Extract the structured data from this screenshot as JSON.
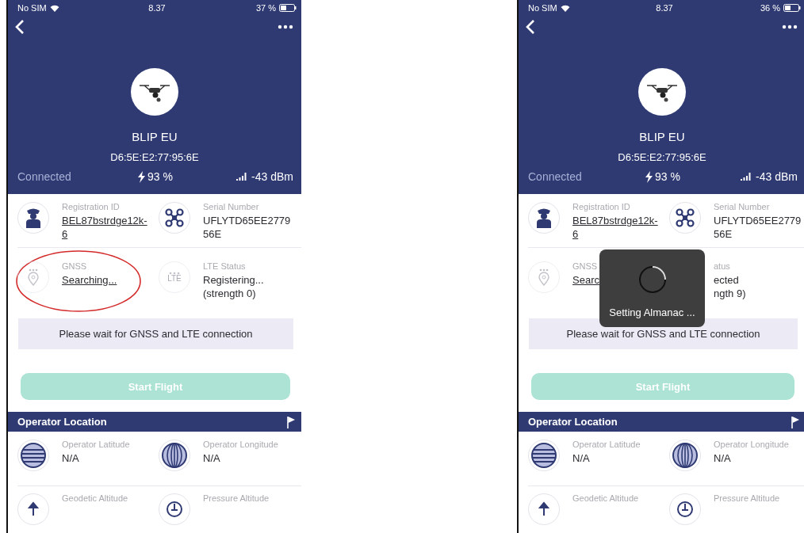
{
  "phones": [
    {
      "status_bar": {
        "carrier": "No SIM",
        "time": "8.37",
        "battery": "37 %"
      },
      "device": {
        "name": "BLIP EU",
        "address": "D6:5E:E2:77:95:6E",
        "connection": "Connected",
        "battery": "93 %",
        "signal": "-43 dBm"
      },
      "info_rows": [
        [
          {
            "kind": "officer",
            "label": "Registration ID",
            "value": "BEL87bstrdge12k-6",
            "link": true
          },
          {
            "kind": "drone",
            "label": "Serial Number",
            "value": "UFLYTD65EE277956E",
            "link": false
          }
        ],
        [
          {
            "kind": "gnss",
            "label": "GNSS",
            "value": "Searching...",
            "link": true,
            "dimmed": true,
            "annotated": true
          },
          {
            "kind": "lte",
            "icon_text": "LTE",
            "label": "LTE Status",
            "value": "Registering... (strength 0)",
            "link": false,
            "dimmed": true
          }
        ]
      ],
      "notice": "Please wait for GNSS and LTE connection",
      "action": {
        "label": "Start Flight",
        "disabled": true
      },
      "section": {
        "title": "Operator Location"
      },
      "location_rows": [
        [
          {
            "kind": "latitude",
            "label": "Operator Latitude",
            "value": "N/A"
          },
          {
            "kind": "longitude",
            "label": "Operator Longitude",
            "value": "N/A"
          }
        ],
        [
          {
            "kind": "geodetic",
            "label": "Geodetic Altitude"
          },
          {
            "kind": "pressure",
            "label": "Pressure Altitude"
          }
        ]
      ]
    },
    {
      "status_bar": {
        "carrier": "No SIM",
        "time": "8.37",
        "battery": "36 %"
      },
      "device": {
        "name": "BLIP EU",
        "address": "D6:5E:E2:77:95:6E",
        "connection": "Connected",
        "battery": "93 %",
        "signal": "-43 dBm"
      },
      "info_rows": [
        [
          {
            "kind": "officer",
            "label": "Registration ID",
            "value": "BEL87bstrdge12k-6",
            "link": true
          },
          {
            "kind": "drone",
            "label": "Serial Number",
            "value": "UFLYTD65EE277956E",
            "link": false
          }
        ],
        [
          {
            "kind": "gnss",
            "label": "GNSS",
            "value": "Searc",
            "link": true,
            "dimmed": true
          },
          {
            "kind": "hidden",
            "label": "atus",
            "value": "ected\nngth 9)",
            "link": false
          }
        ]
      ],
      "notice": "Please wait for GNSS and LTE connection",
      "action": {
        "label": "Start Flight",
        "disabled": true
      },
      "section": {
        "title": "Operator Location"
      },
      "location_rows": [
        [
          {
            "kind": "latitude",
            "label": "Operator Latitude",
            "value": "N/A"
          },
          {
            "kind": "longitude",
            "label": "Operator Longitude",
            "value": "N/A"
          }
        ],
        [
          {
            "kind": "geodetic",
            "label": "Geodetic Altitude"
          },
          {
            "kind": "pressure",
            "label": "Pressure Altitude"
          }
        ]
      ],
      "overlay": {
        "message": "Setting Almanac ..."
      }
    }
  ]
}
